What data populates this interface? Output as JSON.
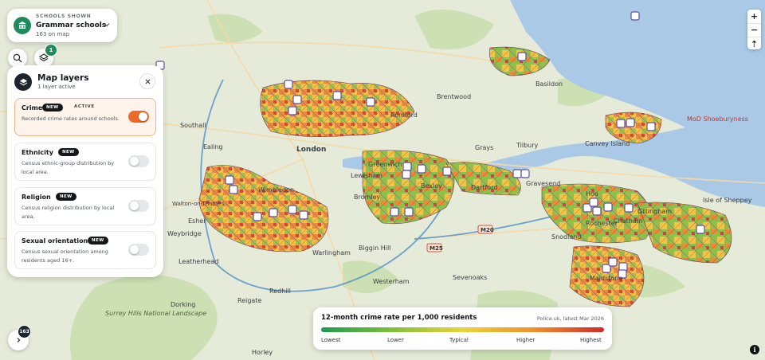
{
  "schools_selector": {
    "eyebrow": "SCHOOLS SHOWN",
    "title": "Grammar schools",
    "subtitle": "163 on map"
  },
  "layers_badge": "1",
  "panel": {
    "title": "Map layers",
    "subtitle": "1 layer active",
    "layers": [
      {
        "name": "Crime",
        "new": "NEW",
        "status": "ACTIVE",
        "desc": "Recorded crime rates around schools.",
        "enabled": true
      },
      {
        "name": "Ethnicity",
        "new": "NEW",
        "desc": "Census ethnic-group distribution by local area.",
        "enabled": false
      },
      {
        "name": "Religion",
        "new": "NEW",
        "desc": "Census religion distribution by local area.",
        "enabled": false
      },
      {
        "name": "Sexual orientation",
        "new": "NEW",
        "desc": "Census sexual orientation among residents aged 16+.",
        "enabled": false
      }
    ]
  },
  "legend": {
    "title": "12-month crime rate per 1,000 residents",
    "source": "Police.uk, latest Mar 2026",
    "labels": [
      "Lowest",
      "Lower",
      "Typical",
      "Higher",
      "Highest"
    ]
  },
  "expand_badge": "163",
  "zoom": {
    "in": "+",
    "out": "−",
    "reset": "⇡"
  },
  "info": "i",
  "map_labels": {
    "london": "London",
    "southall": "Southall",
    "ealing": "Ealing",
    "wimbledon": "Wimbledon",
    "walton": "Walton-on-Thames",
    "esher": "Esher",
    "weybridge": "Weybridge",
    "leatherhead": "Leatherhead",
    "dorking": "Dorking",
    "reigate": "Reigate",
    "redhill": "Redhill",
    "horley": "Horley",
    "surrey_hills": "Surrey Hills National Landscape",
    "warlingham": "Warlingham",
    "biggin_hill": "Biggin Hill",
    "westerham": "Westerham",
    "sevenoaks": "Sevenoaks",
    "greenwich": "Greenwich",
    "lewisham": "Lewisham",
    "bromley": "Bromley",
    "bexley": "Bexley",
    "dartford": "Dartford",
    "gravesend": "Gravesend",
    "grays": "Grays",
    "tilbury": "Tilbury",
    "basildon": "Basildon",
    "canvey": "Canvey Island",
    "hoo": "Hoo",
    "rochester": "Rochester",
    "chatham": "Chatham",
    "gillingham": "Gillingham",
    "snodland": "Snodland",
    "maidstone": "Maidstone",
    "mob": "MoD Shoeburyness",
    "sheppey": "Isle of Sheppey",
    "brentwood": "Brentwood",
    "romford": "Romford",
    "m20": "M20",
    "m25": "M25"
  },
  "colors": {
    "accent": "#ee6a2a",
    "brand": "#1f8a5b",
    "water": "#a9c9e6",
    "land": "#e7ecd9"
  }
}
